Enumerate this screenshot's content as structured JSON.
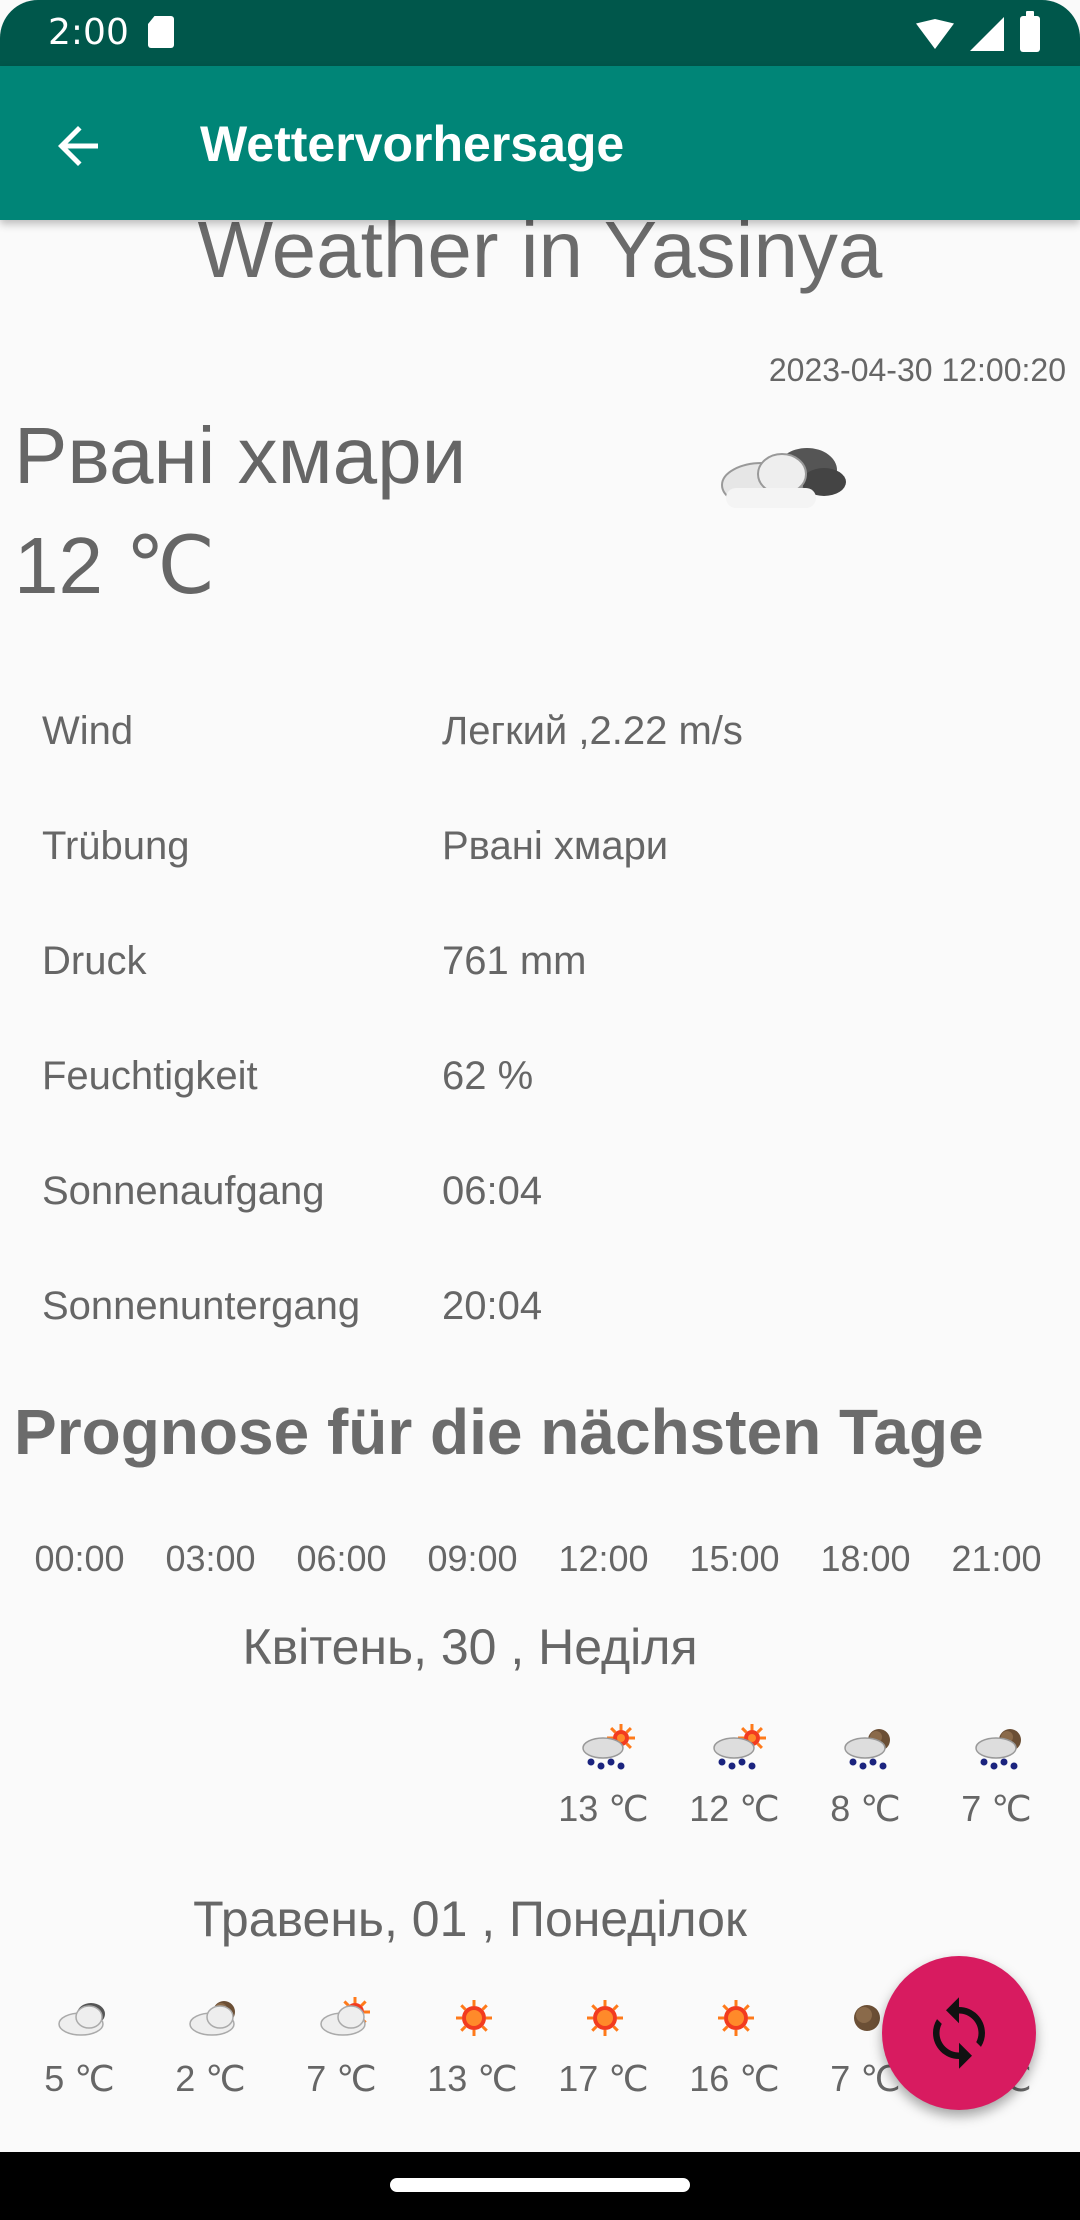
{
  "status_bar": {
    "time": "2:00"
  },
  "app_bar": {
    "title": "Wettervorhersage"
  },
  "city_heading": "Weather in Yasinya",
  "timestamp": "2023-04-30 12:00:20",
  "current": {
    "description": "Рвані хмари",
    "temperature": "12 ℃",
    "icon": "broken-clouds-icon"
  },
  "details": [
    {
      "label": "Wind",
      "value": "Легкий ,2.22 m/s"
    },
    {
      "label": "Trübung",
      "value": "Рвані хмари"
    },
    {
      "label": "Druck",
      "value": "761 mm"
    },
    {
      "label": "Feuchtigkeit",
      "value": "62 %"
    },
    {
      "label": "Sonnenaufgang",
      "value": "06:04"
    },
    {
      "label": "Sonnenuntergang",
      "value": "20:04"
    }
  ],
  "forecast": {
    "title": "Prognose für die nächsten Tage",
    "hours": [
      "00:00",
      "03:00",
      "06:00",
      "09:00",
      "12:00",
      "15:00",
      "18:00",
      "21:00"
    ],
    "days": [
      {
        "title": "Квітень, 30 , Неділя",
        "slots": [
          null,
          null,
          null,
          null,
          {
            "icon": "rain-sun-icon",
            "temp": "13 ℃"
          },
          {
            "icon": "rain-sun-icon",
            "temp": "12 ℃"
          },
          {
            "icon": "rain-night-icon",
            "temp": "8 ℃"
          },
          {
            "icon": "rain-night-icon",
            "temp": "7 ℃"
          }
        ]
      },
      {
        "title": "Травень, 01 , Понеділок",
        "slots": [
          {
            "icon": "broken-clouds-icon",
            "temp": "5 ℃"
          },
          {
            "icon": "cloud-night-icon",
            "temp": "2 ℃"
          },
          {
            "icon": "cloud-sun-icon",
            "temp": "7 ℃"
          },
          {
            "icon": "sun-icon",
            "temp": "13 ℃"
          },
          {
            "icon": "sun-icon",
            "temp": "17 ℃"
          },
          {
            "icon": "sun-icon",
            "temp": "16 ℃"
          },
          {
            "icon": "moon-icon",
            "temp": "7 ℃"
          },
          {
            "icon": "moon-icon",
            "temp": "6 ℃"
          }
        ]
      }
    ]
  },
  "fab": {
    "icon": "refresh-icon"
  },
  "colors": {
    "primary": "#008577",
    "primary_dark": "#00574b",
    "accent": "#d81b60"
  }
}
